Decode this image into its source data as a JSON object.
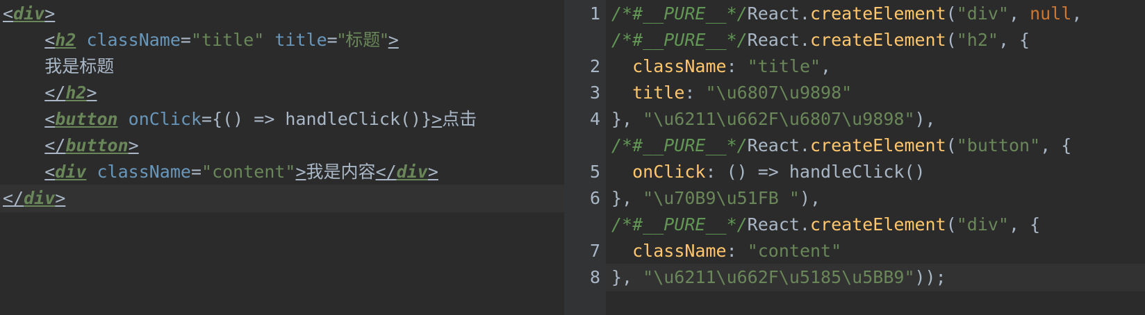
{
  "left_pane": {
    "lines": [
      {
        "open": "<",
        "tag": "div",
        "close": ">"
      },
      {
        "indent": "    ",
        "open": "<",
        "tag": "h2",
        "attr1": " className",
        "eq1": "=",
        "val1": "\"title\"",
        "attr2": " title",
        "eq2": "=",
        "val2": "\"标题\"",
        "close": ">"
      },
      {
        "indent": "    ",
        "text": "我是标题"
      },
      {
        "indent": "    ",
        "open": "</",
        "tag": "h2",
        "close": ">"
      },
      {
        "indent": "    ",
        "open": "<",
        "tag": "button",
        "attr1": " onClick",
        "eq1": "=",
        "expr": "{() => handleClick()}",
        "close": ">",
        "text": "点击"
      },
      {
        "indent": "    ",
        "open": "</",
        "tag": "button",
        "close": ">"
      },
      {
        "indent": "    ",
        "open": "<",
        "tag": "div",
        "attr1": " className",
        "eq1": "=",
        "val1": "\"content\"",
        "close": ">",
        "text": "我是内容",
        "open2": "</",
        "tag2": "div",
        "close2": ">"
      },
      {
        "open": "</",
        "tag": "div",
        "close": ">"
      }
    ]
  },
  "right_pane": {
    "line_numbers": [
      "1",
      "",
      "2",
      "3",
      "4",
      "",
      "5",
      "6",
      "",
      "7",
      "8"
    ],
    "lines": [
      {
        "comment": "/*#__PURE__*/",
        "obj": "React.",
        "fn": "createElement",
        "p1": "(",
        "s1": "\"div\"",
        "p2": ", ",
        "kw": "null",
        "p3": ","
      },
      {
        "comment": "/*#__PURE__*/",
        "obj": "React.",
        "fn": "createElement",
        "p1": "(",
        "s1": "\"h2\"",
        "p2": ", {"
      },
      {
        "indent": "  ",
        "prop": "className",
        "p1": ": ",
        "s1": "\"title\"",
        "p2": ","
      },
      {
        "indent": "  ",
        "prop": "title",
        "p1": ": ",
        "s1": "\"\\u6807\\u9898\""
      },
      {
        "p0": "}, ",
        "s1": "\"\\u6211\\u662F\\u6807\\u9898\"",
        "p2": "),"
      },
      {
        "comment": "/*#__PURE__*/",
        "obj": "React.",
        "fn": "createElement",
        "p1": "(",
        "s1": "\"button\"",
        "p2": ", {"
      },
      {
        "indent": "  ",
        "prop": "onClick",
        "p1": ": () => handleClick()"
      },
      {
        "p0": "}, ",
        "s1": "\"\\u70B9\\u51FB \"",
        "p2": "),"
      },
      {
        "comment": "/*#__PURE__*/",
        "obj": "React.",
        "fn": "createElement",
        "p1": "(",
        "s1": "\"div\"",
        "p2": ", {"
      },
      {
        "indent": "  ",
        "prop": "className",
        "p1": ": ",
        "s1": "\"content\""
      },
      {
        "p0": "}, ",
        "s1": "\"\\u6211\\u662F\\u5185\\u5BB9\"",
        "p2": "));"
      }
    ]
  },
  "colors": {
    "background": "#2b2b2b",
    "gutter": "#313335",
    "current_line": "#323232",
    "tag_name": "#6a8759",
    "string": "#6a8759",
    "attribute": "#6897bb",
    "function": "#ffc66d",
    "keyword": "#cc7832",
    "comment": "#629755",
    "text": "#a9b7c6"
  }
}
